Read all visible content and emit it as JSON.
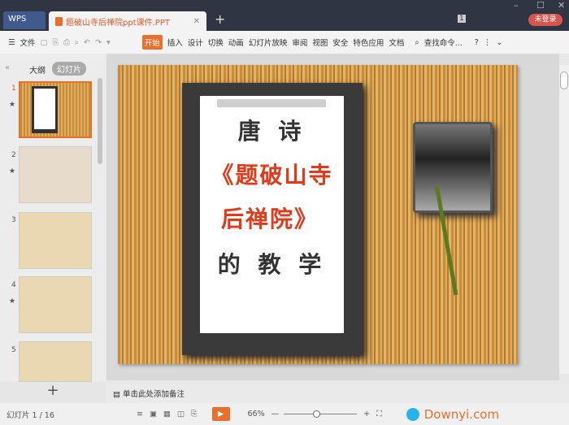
{
  "titlebar": {
    "app": "WPS",
    "doc_title": "题破山寺后禅院ppt课件.PPT",
    "login": "未登录",
    "badge": "1"
  },
  "menu": {
    "file": "文件",
    "items": [
      "开始",
      "插入",
      "设计",
      "切换",
      "动画",
      "幻灯片放映",
      "审阅",
      "视图",
      "安全",
      "特色应用",
      "文档"
    ],
    "search": "查找命令..."
  },
  "pane": {
    "tabs": [
      "大纲",
      "幻灯片"
    ],
    "slides": [
      {
        "n": "1"
      },
      {
        "n": "2"
      },
      {
        "n": "3"
      },
      {
        "n": "4"
      },
      {
        "n": "5"
      }
    ],
    "add": "+"
  },
  "slide": {
    "line1": "唐 诗",
    "line2": "《题破山寺",
    "line3": "后禅院》",
    "line4": "的 教 学"
  },
  "notes": {
    "placeholder": "单击此处添加备注"
  },
  "status": {
    "slide_counter": "幻灯片 1 / 16",
    "zoom": "66%",
    "watermark": "Downyi.com"
  }
}
